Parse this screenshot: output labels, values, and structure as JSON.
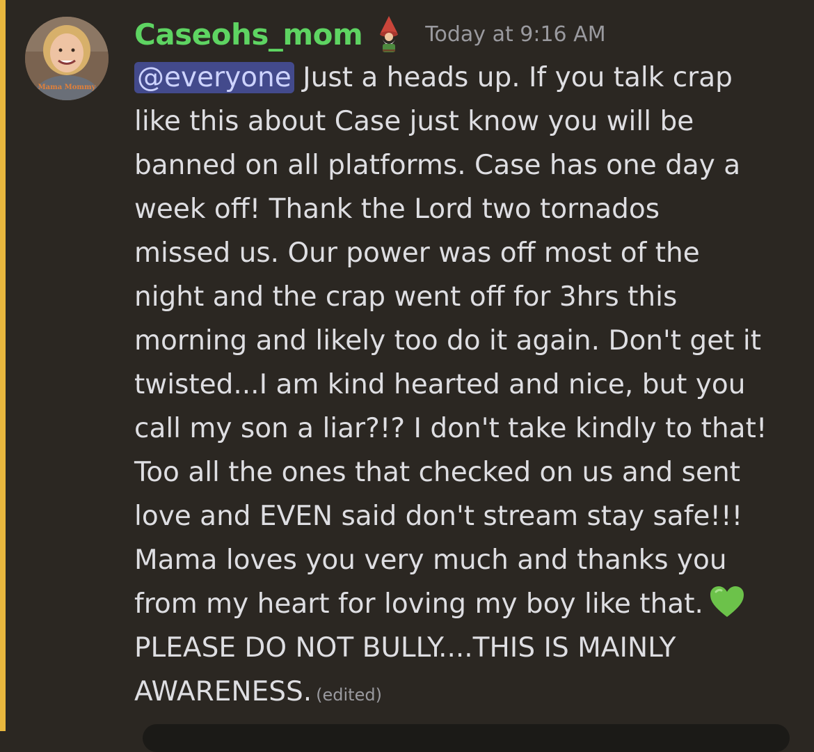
{
  "message": {
    "author": "Caseohs_mom",
    "timestamp": "Today at 9:16 AM",
    "badge_icon": "gnome-icon",
    "avatar_icon": "user-avatar",
    "avatar_shirt_text": "Mama Mommy",
    "mention": "@everyone",
    "lines": [
      " Just a heads up. If you talk crap",
      "like this about Case just know you will be",
      "banned on all platforms.  Case has one day a",
      "week off! Thank the Lord two tornados",
      "missed us.  Our power was off most of the",
      "night and the crap went off for 3hrs this",
      "morning and likely too do it again.  Don't get it",
      "twisted...I am kind hearted and nice, but you",
      "call my son a liar?!? I don't take kindly to that!",
      "Too all the ones that checked on us and sent",
      "love and EVEN said don't stream stay safe!!!",
      "Mama loves you very much and thanks you",
      "from my heart for loving my boy like that.",
      "PLEASE DO NOT BULLY....THIS IS MAINLY",
      "AWARENESS."
    ],
    "heart_emoji": "green-heart-icon",
    "edited_label": "(edited)"
  },
  "colors": {
    "background": "#2b2722",
    "accent_bar": "#e8b73e",
    "username": "#5ed462",
    "text": "#dedee2",
    "muted": "#9a9a9f",
    "mention_bg": "#434a8c"
  }
}
